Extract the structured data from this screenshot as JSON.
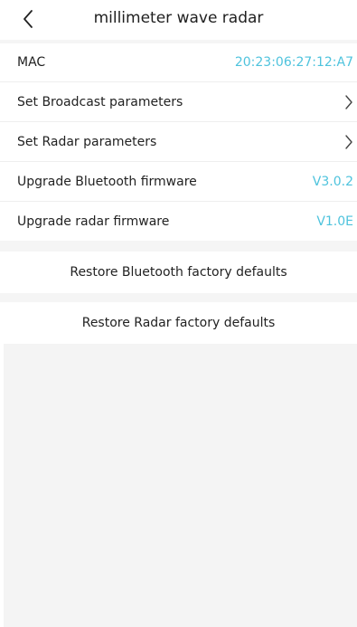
{
  "header": {
    "title": "millimeter wave radar",
    "back_icon": "chevron-left-icon"
  },
  "rows": {
    "mac": {
      "label": "MAC",
      "value": "20:23:06:27:12:A7"
    },
    "broadcast": {
      "label": "Set Broadcast parameters",
      "icon": "chevron-right-icon"
    },
    "radar": {
      "label": "Set Radar parameters",
      "icon": "chevron-right-icon"
    },
    "bt_firmware": {
      "label": "Upgrade Bluetooth firmware",
      "value": "V3.0.2"
    },
    "radar_firmware": {
      "label": "Upgrade radar firmware",
      "value": "V1.0E"
    }
  },
  "actions": {
    "restore_bt": "Restore Bluetooth factory defaults",
    "restore_radar": "Restore Radar factory defaults"
  },
  "colors": {
    "accent": "#4ec3dd",
    "background": "#f4f4f4"
  }
}
